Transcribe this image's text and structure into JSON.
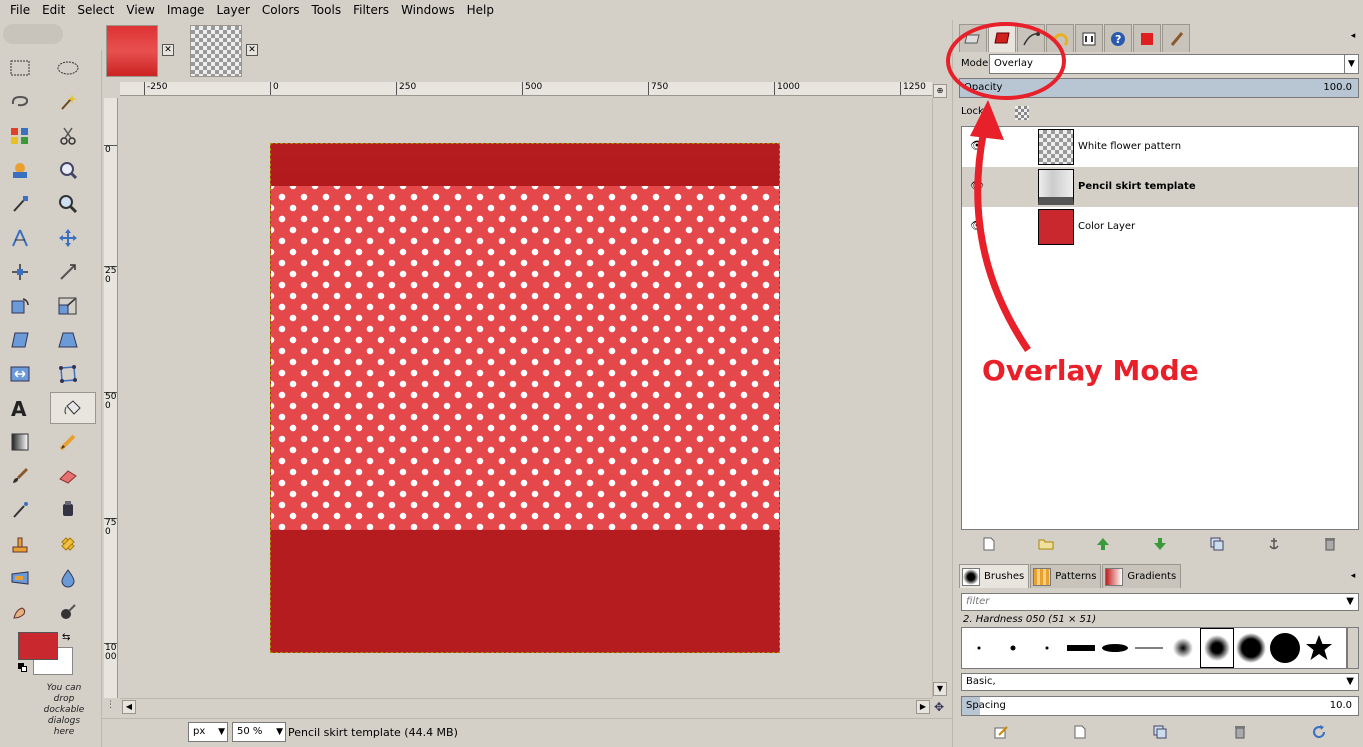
{
  "menu": [
    "File",
    "Edit",
    "Select",
    "View",
    "Image",
    "Layer",
    "Colors",
    "Tools",
    "Filters",
    "Windows",
    "Help"
  ],
  "toolbox": {
    "dock_hint": "You can drop dockable dialogs here",
    "fg_color": "#c8282e",
    "bg_color": "#ffffff"
  },
  "image_tabs": [
    {
      "name": "red-image-tab",
      "close": "✕"
    },
    {
      "name": "checker-image-tab",
      "close": "✕"
    }
  ],
  "ruler": {
    "h_ticks": [
      "-250",
      "0",
      "250",
      "500",
      "750",
      "1000",
      "1250"
    ],
    "v_ticks": [
      "0",
      "250",
      "500",
      "750",
      "1000"
    ]
  },
  "statusbar": {
    "unit": "px",
    "zoom": "50 %",
    "status": "Pencil skirt template (44.4 MB)"
  },
  "layers_panel": {
    "mode_label": "Mode:",
    "mode_value": "Overlay",
    "opacity_label": "Opacity",
    "opacity_value": "100.0",
    "lock_label": "Lock:",
    "layers": [
      {
        "name": "White flower pattern",
        "selected": false
      },
      {
        "name": "Pencil skirt template",
        "selected": true
      },
      {
        "name": "Color Layer",
        "selected": false
      }
    ]
  },
  "brushes_panel": {
    "tabs": [
      "Brushes",
      "Patterns",
      "Gradients"
    ],
    "filter_placeholder": "filter",
    "brush_name": "2. Hardness 050 (51 × 51)",
    "preset": "Basic,",
    "spacing_label": "Spacing",
    "spacing_value": "10.0"
  },
  "annotation": {
    "text": "Overlay Mode",
    "color": "#e8202a"
  }
}
